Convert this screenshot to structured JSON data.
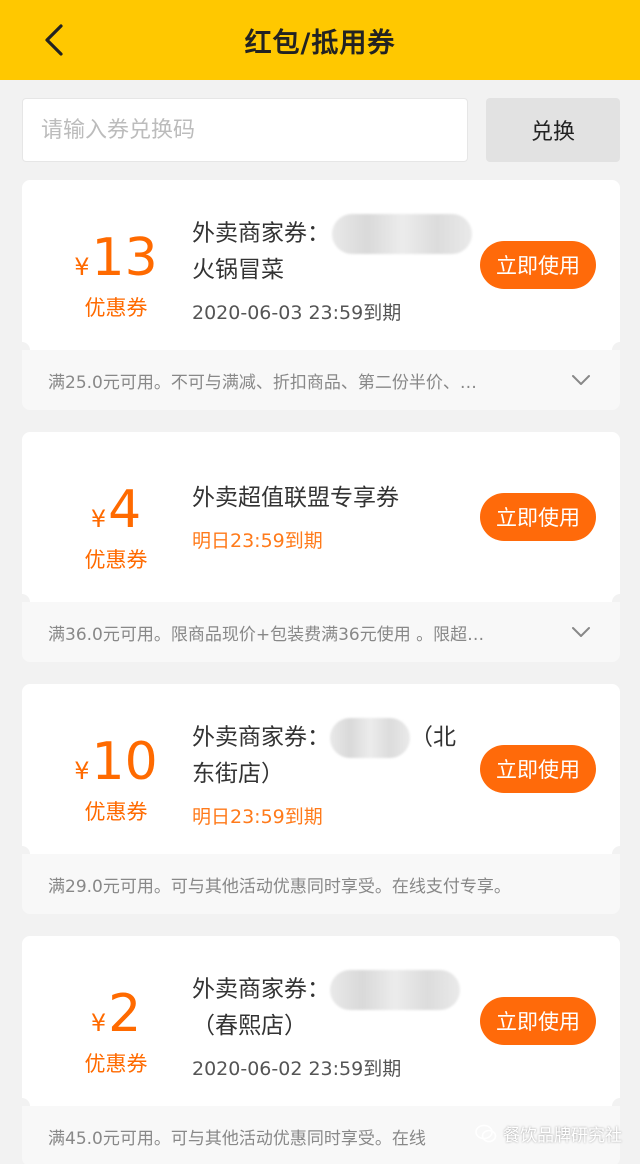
{
  "header": {
    "title": "红包/抵用券",
    "back_icon": "chevron-left-icon"
  },
  "redeem": {
    "placeholder": "请输入券兑换码",
    "button": "兑换"
  },
  "coupons": [
    {
      "currency": "¥",
      "amount": "13",
      "amount_label": "优惠券",
      "title_prefix": "外卖商家券：",
      "title_suffix": "火锅冒菜",
      "expiry": "2020-06-03 23:59到期",
      "use_button": "立即使用",
      "desc": "满25.0元可用。不可与满减、折扣商品、第二份半价、…",
      "expand_icon": "chevron-down-icon"
    },
    {
      "currency": "¥",
      "amount": "4",
      "amount_label": "优惠券",
      "title_prefix": "外卖超值联盟专享券",
      "title_suffix": "",
      "expiry": "明日23:59到期",
      "use_button": "立即使用",
      "desc": "满36.0元可用。限商品现价+包装费满36元使用 。限超…",
      "expand_icon": "chevron-down-icon"
    },
    {
      "currency": "¥",
      "amount": "10",
      "amount_label": "优惠券",
      "title_prefix": "外卖商家券：",
      "title_mid": "（北",
      "title_suffix": "东街店）",
      "expiry": "明日23:59到期",
      "use_button": "立即使用",
      "desc": "满29.0元可用。可与其他活动优惠同时享受。在线支付专享。"
    },
    {
      "currency": "¥",
      "amount": "2",
      "amount_label": "优惠券",
      "title_prefix": "外卖商家券：",
      "title_suffix": "（春熙店）",
      "expiry": "2020-06-02 23:59到期",
      "use_button": "立即使用",
      "desc": "满45.0元可用。可与其他活动优惠同时享受。在线"
    }
  ],
  "watermark": {
    "text": "餐饮品牌研究社"
  },
  "colors": {
    "header": "#ffc800",
    "accent": "#ff6a0a",
    "price": "#ff6a00"
  }
}
